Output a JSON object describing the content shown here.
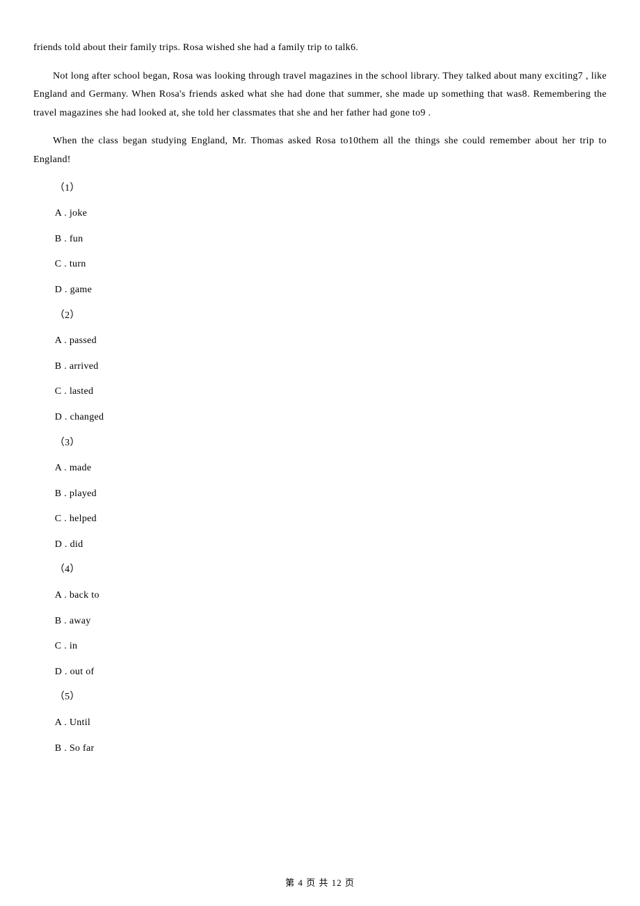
{
  "paragraphs": {
    "p1": "friends told about their family trips. Rosa wished she had a family trip to talk6.",
    "p2": "Not long after school began, Rosa was looking through travel magazines in the school library. They talked about many exciting7 , like England and Germany. When Rosa's friends asked what she had done that summer, she made up something that was8. Remembering the travel magazines she had looked at, she told her classmates that she and her father had gone to9 .",
    "p3": "When the class began studying England, Mr. Thomas asked Rosa to10them all the things she could remember about her trip to England!"
  },
  "questions": [
    {
      "num": "（1）",
      "options": [
        "A . joke",
        "B . fun",
        "C . turn",
        "D . game"
      ]
    },
    {
      "num": "（2）",
      "options": [
        "A . passed",
        "B . arrived",
        "C . lasted",
        "D . changed"
      ]
    },
    {
      "num": "（3）",
      "options": [
        "A . made",
        "B . played",
        "C . helped",
        "D . did"
      ]
    },
    {
      "num": "（4）",
      "options": [
        "A . back to",
        "B . away",
        "C . in",
        "D . out of"
      ]
    },
    {
      "num": "（5）",
      "options": [
        "A . Until",
        "B . So far"
      ]
    }
  ],
  "footer": "第 4 页 共 12 页"
}
